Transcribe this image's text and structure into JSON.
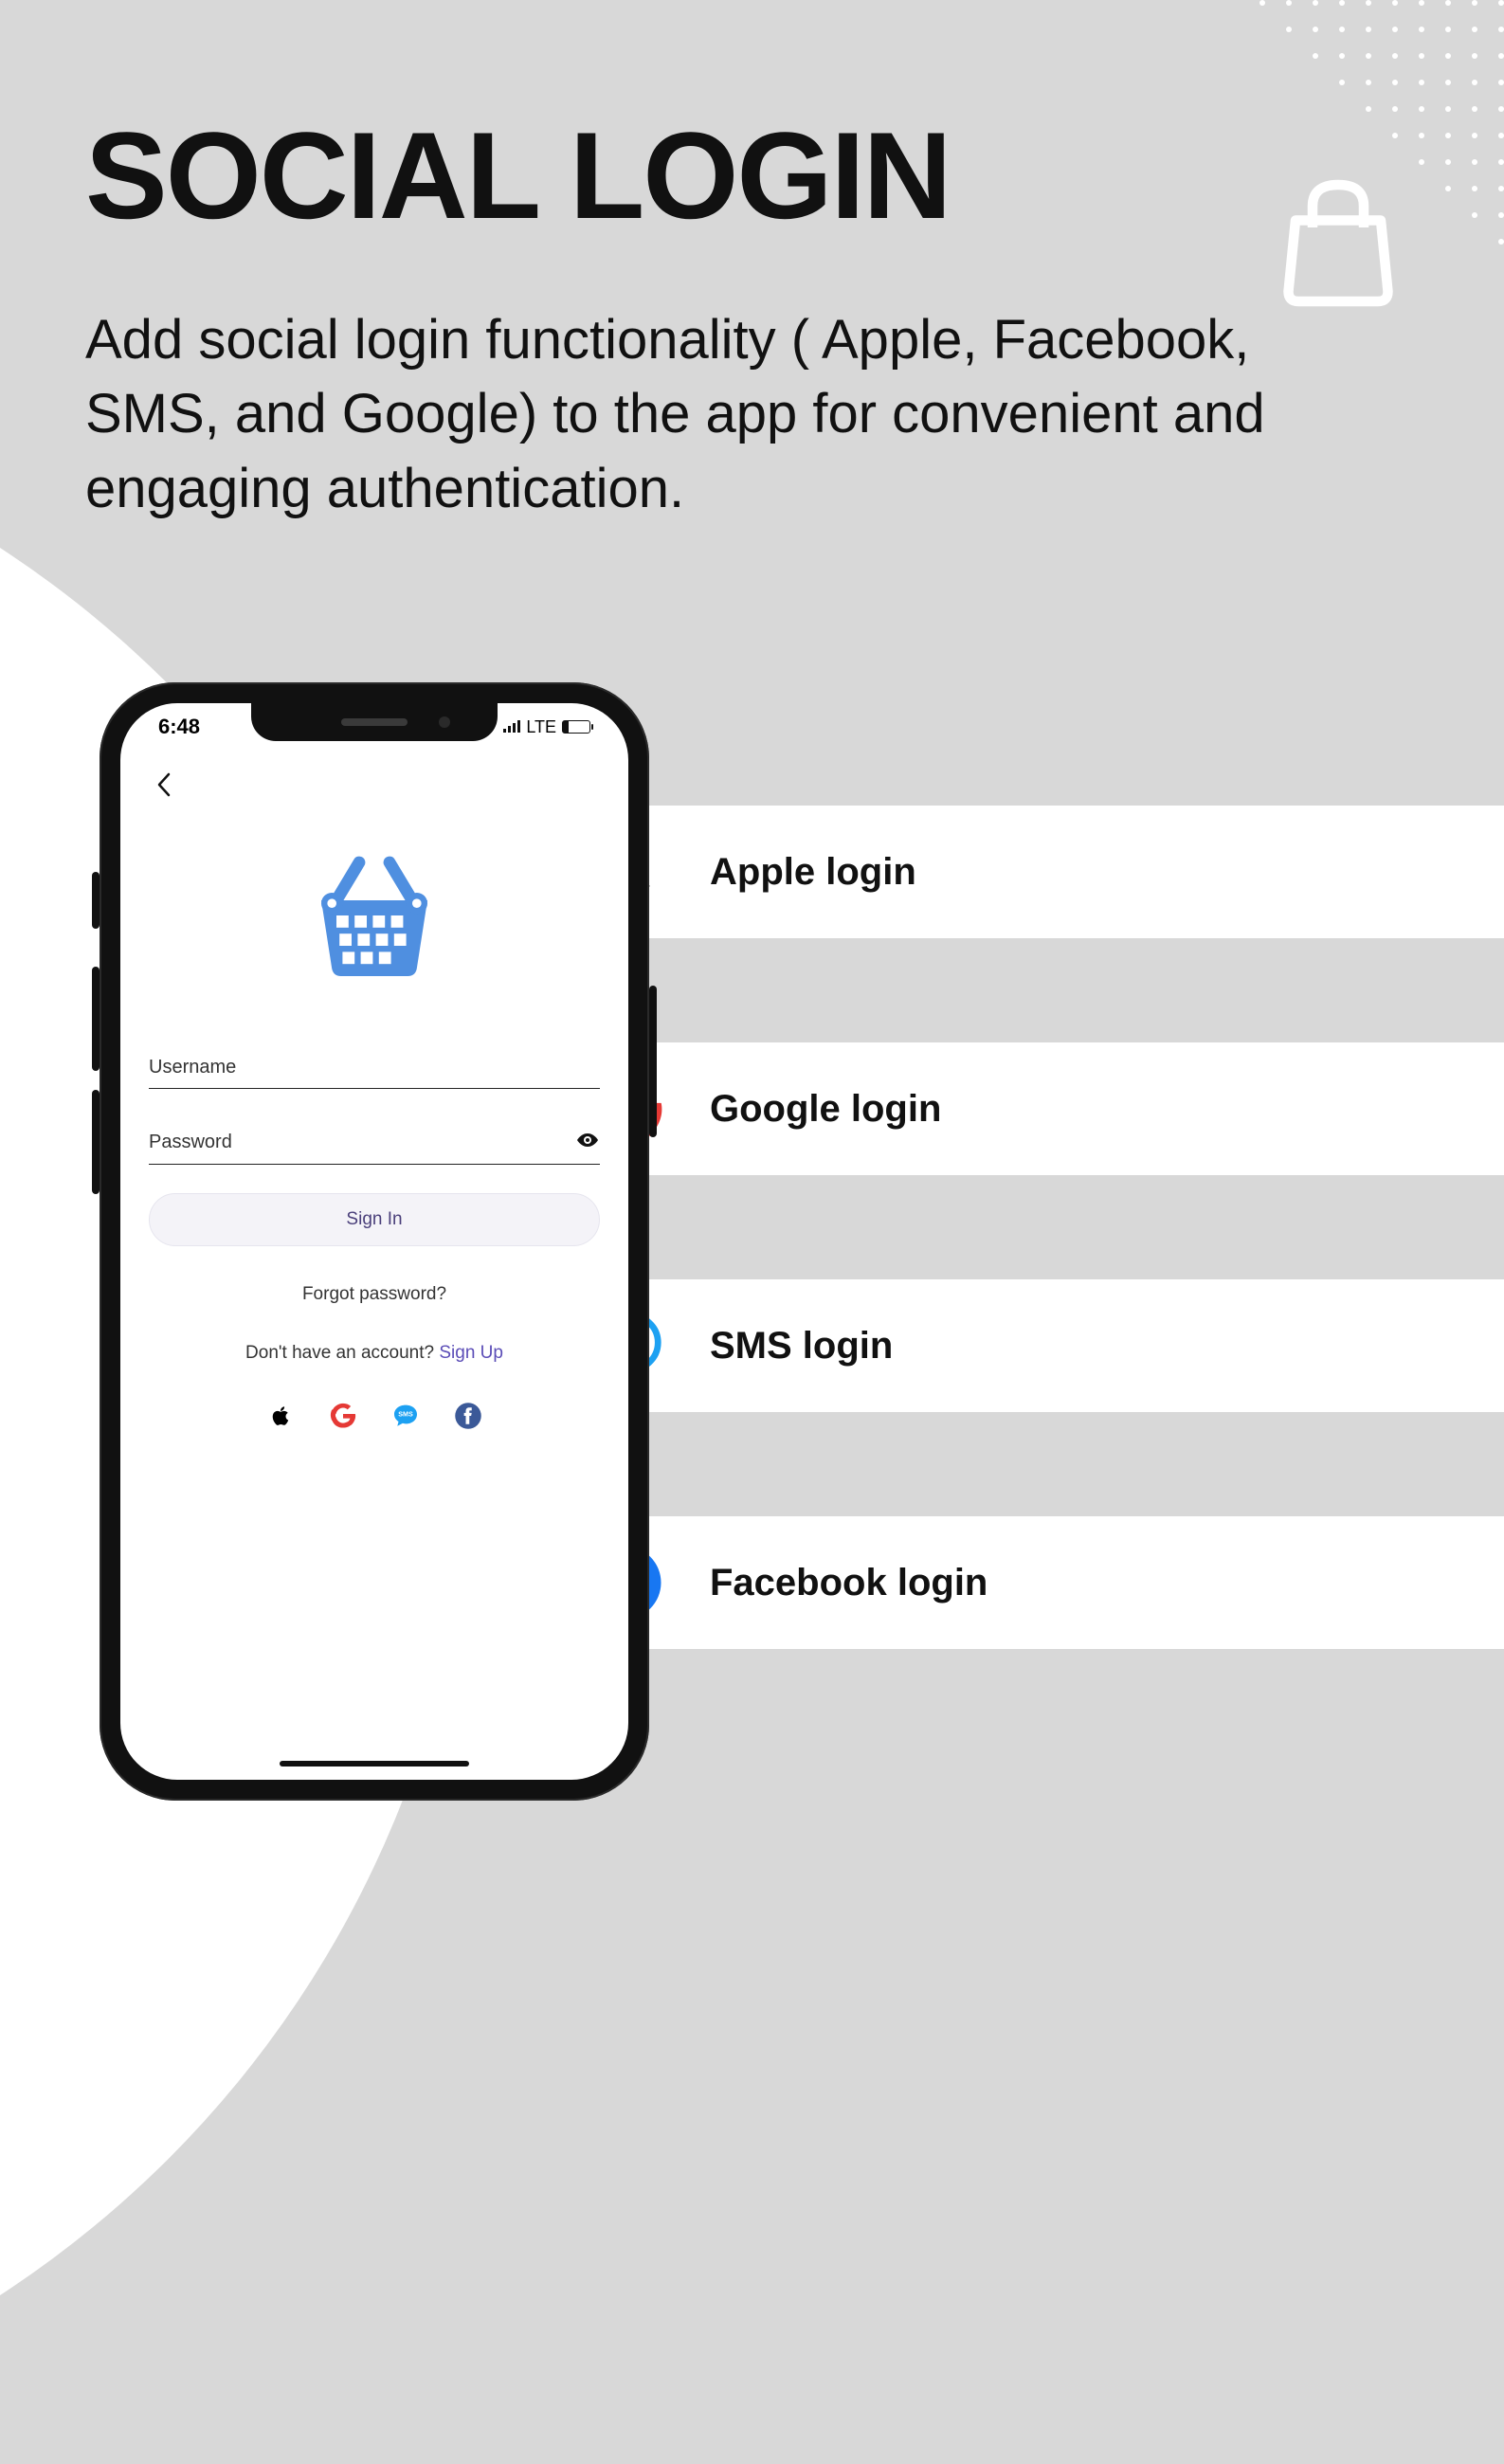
{
  "page": {
    "title": "SOCIAL LOGIN",
    "description": "Add social login functionality ( Apple, Facebook, SMS, and Google) to the app for convenient and engaging authentication."
  },
  "pills": {
    "apple": "Apple login",
    "google": "Google login",
    "sms": "SMS login",
    "facebook": "Facebook login"
  },
  "phone": {
    "status_time": "6:48",
    "network_label": "LTE",
    "username_label": "Username",
    "password_label": "Password",
    "signin_label": "Sign In",
    "forgot_label": "Forgot password?",
    "no_account_label": "Don't have an account?  ",
    "signup_label": "Sign Up"
  }
}
